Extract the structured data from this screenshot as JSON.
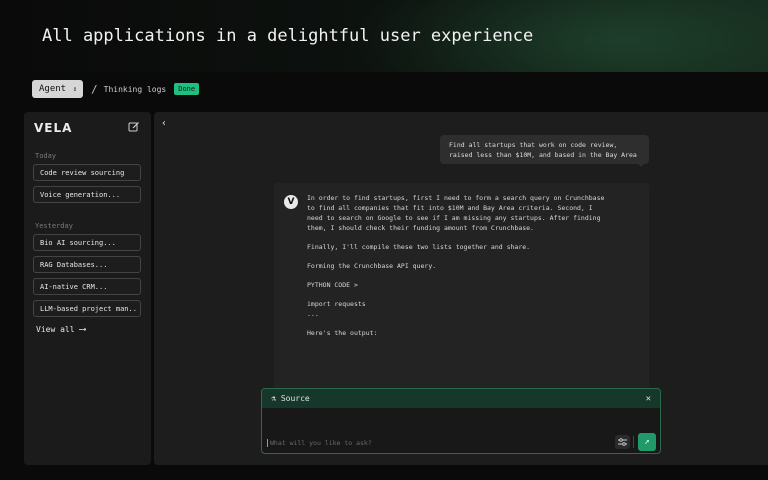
{
  "hero": {
    "title": "All applications in a delightful user experience"
  },
  "breadcrumb": {
    "agent_label": "Agent",
    "separator": "/",
    "page": "Thinking logs",
    "status": "Done"
  },
  "sidebar": {
    "logo": "VELA",
    "today_label": "Today",
    "today_items": [
      "Code review sourcing",
      "Voice generation..."
    ],
    "yesterday_label": "Yesterday",
    "yesterday_items": [
      "Bio AI sourcing...",
      "RAG Databases...",
      "AI-native CRM...",
      "LLM-based project man.."
    ],
    "view_all": "View all",
    "view_all_arrow": "⟶"
  },
  "chat": {
    "user_message": "Find all startups that work on code review, raised less than $10M, and based in the Bay Area",
    "agent_avatar": "V",
    "agent_paragraphs": [
      "In order to find startups, first I need to form a search query on Crunchbase to find all companies that fit into $10M and Bay Area criteria. Second, I need to search on Google to see if I am missing any startups. After finding them, I should check their funding amount from Crunchbase.",
      "Finally, I'll compile these two lists together and share.",
      "Forming the Crunchbase API query.",
      "PYTHON CODE >"
    ],
    "code_lines": [
      "import requests",
      "..."
    ],
    "output_label": "Here's the output:"
  },
  "source": {
    "title": "Source",
    "close": "✕",
    "placeholder": "What will you like to ask?",
    "send_glyph": "↗"
  },
  "colors": {
    "accent": "#1f9a69",
    "badge": "#1fbf7f",
    "source_border": "#2a6b4e"
  }
}
